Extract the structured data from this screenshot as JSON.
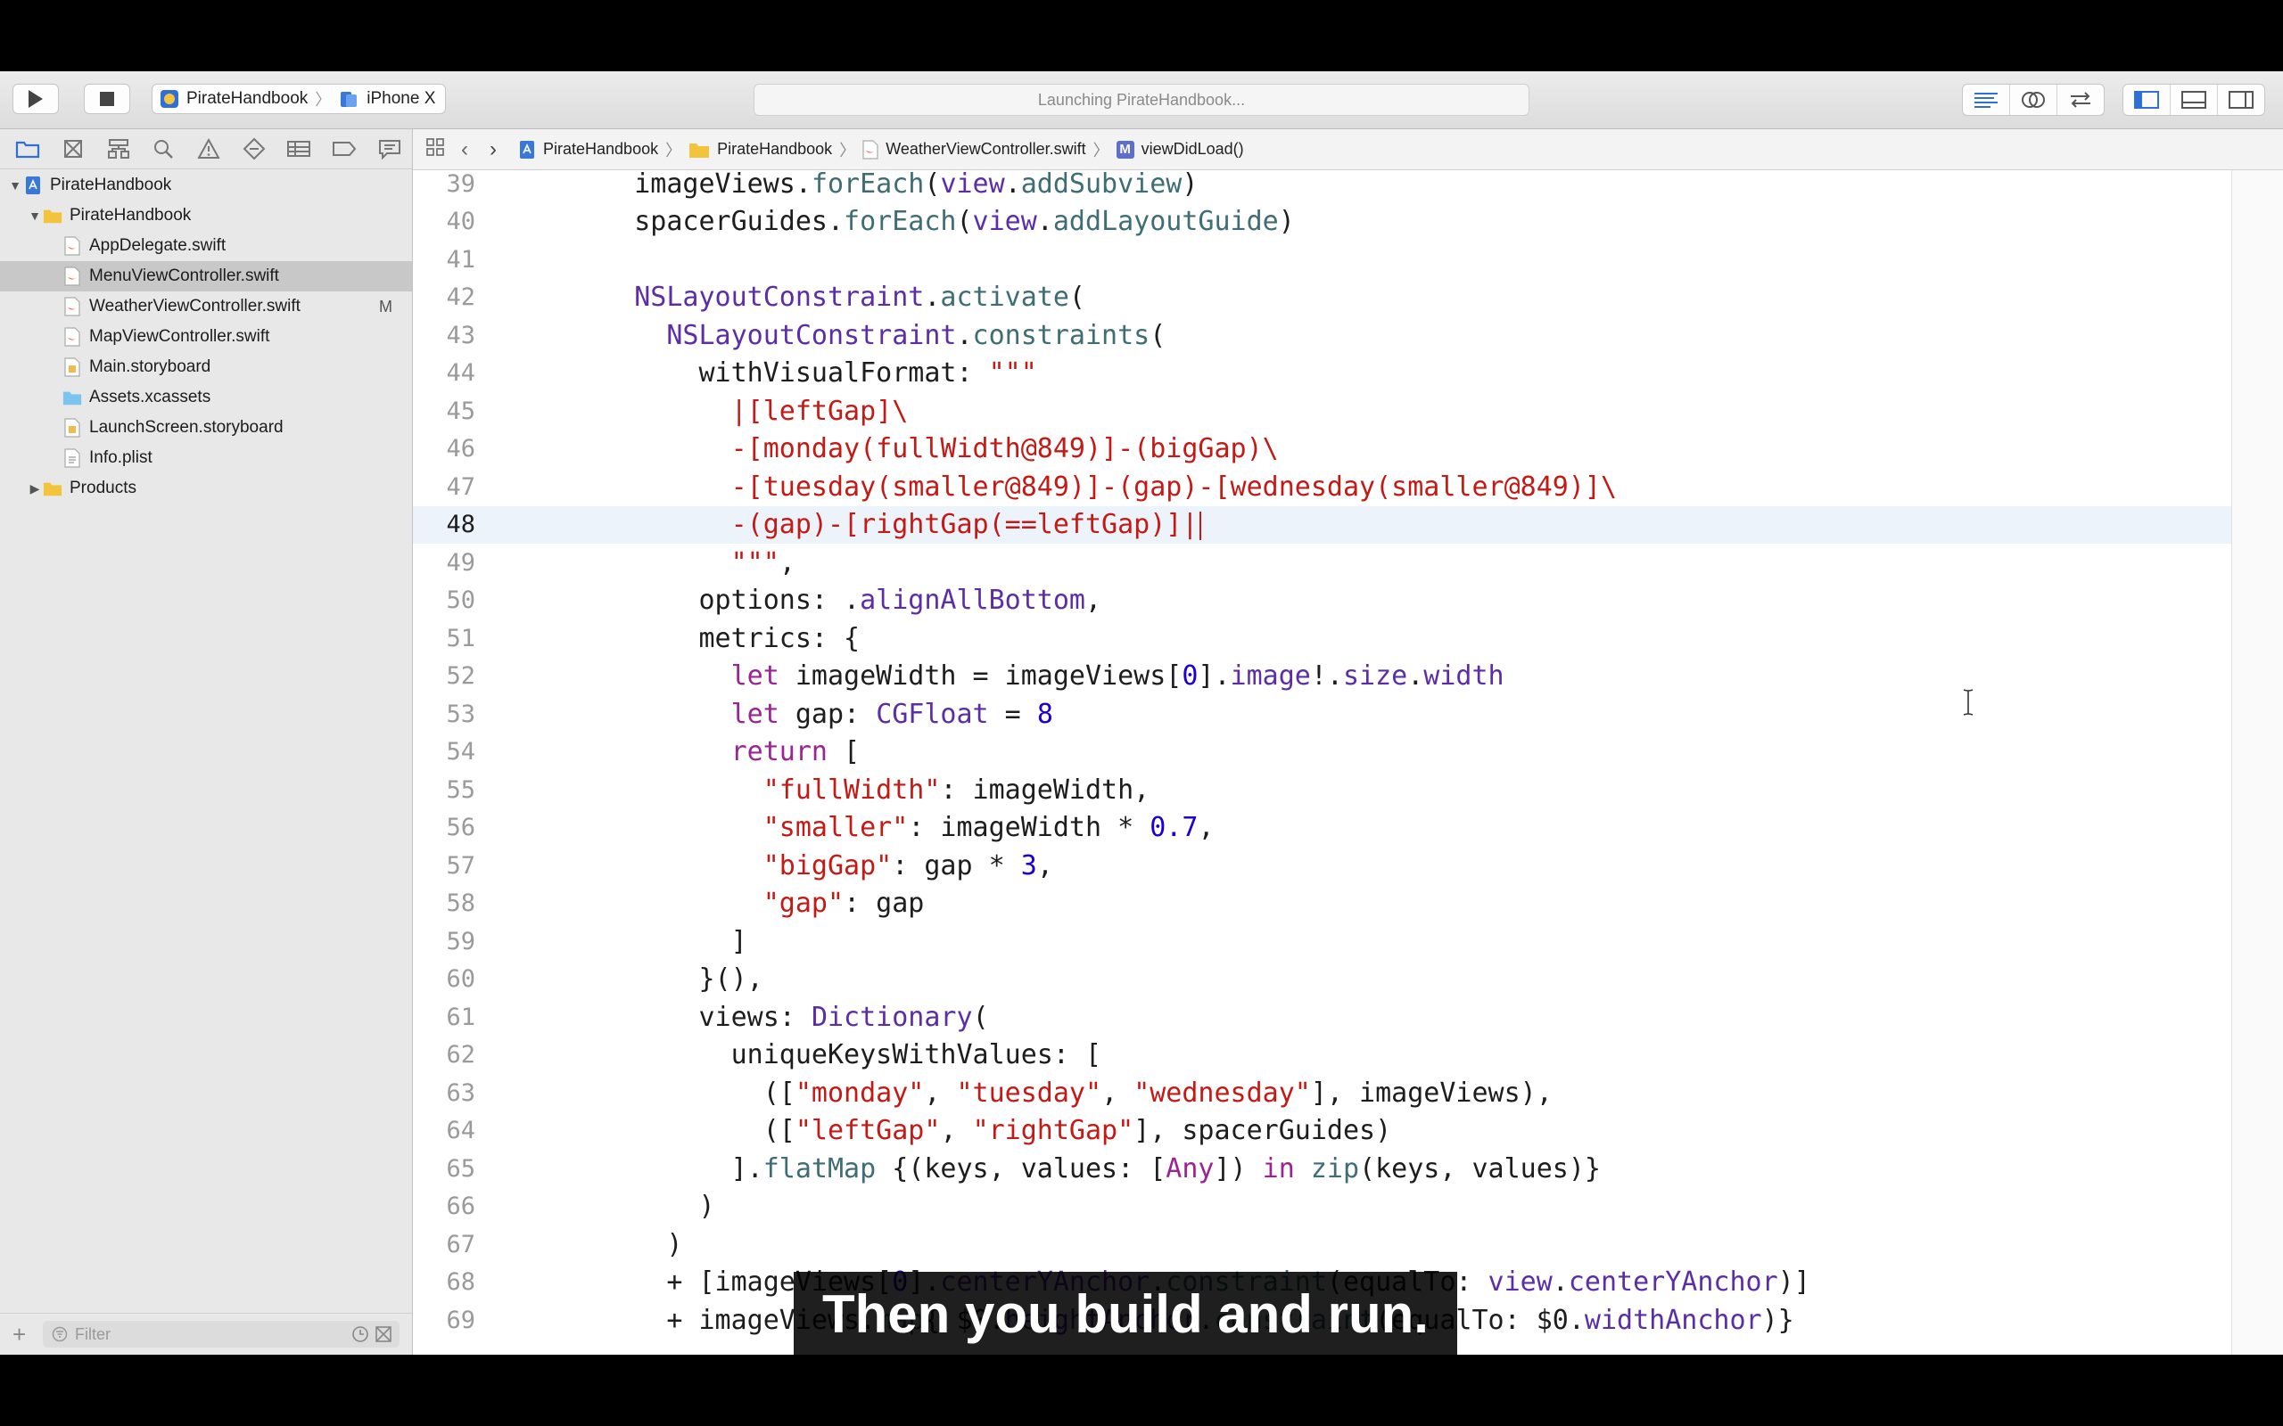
{
  "toolbar": {
    "scheme": "PirateHandbook",
    "device": "iPhone X",
    "activity": "Launching PirateHandbook..."
  },
  "navigator": {
    "filter_placeholder": "Filter",
    "items": [
      {
        "label": "PirateHandbook",
        "level": 0,
        "kind": "project",
        "open": true
      },
      {
        "label": "PirateHandbook",
        "level": 1,
        "kind": "folder",
        "open": true
      },
      {
        "label": "AppDelegate.swift",
        "level": 2,
        "kind": "swift"
      },
      {
        "label": "MenuViewController.swift",
        "level": 2,
        "kind": "swift",
        "selected": true
      },
      {
        "label": "WeatherViewController.swift",
        "level": 2,
        "kind": "swift",
        "badge": "M"
      },
      {
        "label": "MapViewController.swift",
        "level": 2,
        "kind": "swift"
      },
      {
        "label": "Main.storyboard",
        "level": 2,
        "kind": "storyboard"
      },
      {
        "label": "Assets.xcassets",
        "level": 2,
        "kind": "assets"
      },
      {
        "label": "LaunchScreen.storyboard",
        "level": 2,
        "kind": "storyboard"
      },
      {
        "label": "Info.plist",
        "level": 2,
        "kind": "plist"
      },
      {
        "label": "Products",
        "level": 1,
        "kind": "folder",
        "open": false
      }
    ]
  },
  "jumpbar": {
    "project": "PirateHandbook",
    "group": "PirateHandbook",
    "file": "WeatherViewController.swift",
    "method_icon": "M",
    "method": "viewDidLoad()"
  },
  "editor": {
    "current_line": 48,
    "lines": [
      {
        "n": 39,
        "html": "    imageViews.<span class='m'>forEach</span>(<span class='t'>view</span>.<span class='m'>addSubview</span>)"
      },
      {
        "n": 40,
        "html": "    spacerGuides.<span class='m'>forEach</span>(<span class='t'>view</span>.<span class='m'>addLayoutGuide</span>)"
      },
      {
        "n": 41,
        "html": ""
      },
      {
        "n": 42,
        "html": "    <span class='t'>NSLayoutConstraint</span>.<span class='m'>activate</span>("
      },
      {
        "n": 43,
        "html": "      <span class='t'>NSLayoutConstraint</span>.<span class='m'>constraints</span>("
      },
      {
        "n": 44,
        "html": "        withVisualFormat: <span class='s'>\"\"\"</span>"
      },
      {
        "n": 45,
        "html": "<span class='s'>          |[leftGap]\\</span>"
      },
      {
        "n": 46,
        "html": "<span class='s'>          -[monday(fullWidth@849)]-(bigGap)\\</span>"
      },
      {
        "n": 47,
        "html": "<span class='s'>          -[tuesday(smaller@849)]-(gap)-[wednesday(smaller@849)]\\</span>"
      },
      {
        "n": 48,
        "html": "<span class='s'>          -(gap)-[rightGap(==leftGap)]|</span>"
      },
      {
        "n": 49,
        "html": "<span class='s'>          \"\"\"</span>,"
      },
      {
        "n": 50,
        "html": "        options: .<span class='t'>alignAllBottom</span>,"
      },
      {
        "n": 51,
        "html": "        metrics: {"
      },
      {
        "n": 52,
        "html": "          <span class='k'>let</span> imageWidth = imageViews[<span class='n'>0</span>].<span class='t'>image</span>!.<span class='t'>size</span>.<span class='t'>width</span>"
      },
      {
        "n": 53,
        "html": "          <span class='k'>let</span> gap: <span class='t'>CGFloat</span> = <span class='n'>8</span>"
      },
      {
        "n": 54,
        "html": "          <span class='k'>return</span> ["
      },
      {
        "n": 55,
        "html": "            <span class='s'>\"fullWidth\"</span>: imageWidth,"
      },
      {
        "n": 56,
        "html": "            <span class='s'>\"smaller\"</span>: imageWidth * <span class='n'>0.7</span>,"
      },
      {
        "n": 57,
        "html": "            <span class='s'>\"bigGap\"</span>: gap * <span class='n'>3</span>,"
      },
      {
        "n": 58,
        "html": "            <span class='s'>\"gap\"</span>: gap"
      },
      {
        "n": 59,
        "html": "          ]"
      },
      {
        "n": 60,
        "html": "        }(),"
      },
      {
        "n": 61,
        "html": "        views: <span class='t'>Dictionary</span>("
      },
      {
        "n": 62,
        "html": "          uniqueKeysWithValues: ["
      },
      {
        "n": 63,
        "html": "            ([<span class='s'>\"monday\"</span>, <span class='s'>\"tuesday\"</span>, <span class='s'>\"wednesday\"</span>], imageViews),"
      },
      {
        "n": 64,
        "html": "            ([<span class='s'>\"leftGap\"</span>, <span class='s'>\"rightGap\"</span>], spacerGuides)"
      },
      {
        "n": 65,
        "html": "          ].<span class='m'>flatMap</span> {(keys, values: [<span class='k'>Any</span>]) <span class='k'>in</span> <span class='m'>zip</span>(keys, values)}"
      },
      {
        "n": 66,
        "html": "        )"
      },
      {
        "n": 67,
        "html": "      )"
      },
      {
        "n": 68,
        "html": "      + [imageViews[<span class='n'>0</span>].<span class='t'>centerYAnchor</span>.<span class='m'>constraint</span>(equalTo: <span class='t'>view</span>.<span class='t'>centerYAnchor</span>)]"
      },
      {
        "n": 69,
        "html": "      + imageViews.<span class='m'>map</span>{ $0.<span class='t'>heightAnchor</span>.<span class='m'>constraint</span>(equalTo: $0.<span class='t'>widthAnchor</span>)}"
      }
    ]
  },
  "caption": "Then you build and run.",
  "colors": {
    "keyword": "#9b2393",
    "type": "#5b2ea8",
    "method": "#3e6d74",
    "string": "#c41a16",
    "number": "#1c00cf",
    "selection": "#c8c8c8",
    "current_line": "#ecf3fb"
  }
}
